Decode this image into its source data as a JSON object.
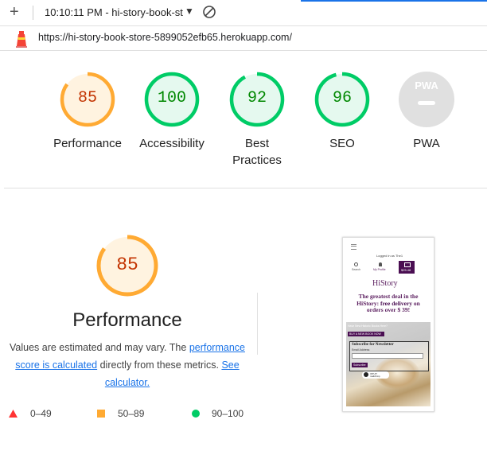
{
  "toolbar": {
    "time_title": "10:10:11 PM - hi-story-book-st"
  },
  "urlbar": {
    "url": "https://hi-story-book-store-5899052efb65.herokuapp.com/"
  },
  "colors": {
    "average": "#fa3",
    "average_text": "#c33300",
    "average_bg": "#fff3e0",
    "pass": "#0c6",
    "pass_text": "#008800",
    "pass_bg": "#e5f9ef",
    "fail": "#f33",
    "na": "#e0e0e0",
    "link": "#1a73e8"
  },
  "gauges": [
    {
      "score": "85",
      "label": "Performance",
      "rating": "average"
    },
    {
      "score": "100",
      "label": "Accessibility",
      "rating": "pass"
    },
    {
      "score": "92",
      "label": "Best Practices",
      "rating": "pass"
    },
    {
      "score": "96",
      "label": "SEO",
      "rating": "pass"
    },
    {
      "score": "PWA",
      "label": "PWA",
      "rating": "na"
    }
  ],
  "performance": {
    "score": "85",
    "title": "Performance",
    "note_prefix": "Values are estimated and may vary. The",
    "note_link": "performance score is calculated",
    "note_middle": "directly from these metrics.",
    "calculator_link": "See calculator."
  },
  "legend": [
    {
      "range": "0–49",
      "shape": "triangle"
    },
    {
      "range": "50–89",
      "shape": "square"
    },
    {
      "range": "90–100",
      "shape": "circle"
    }
  ],
  "screenshot": {
    "logged_in": "Logged in as The1",
    "search": "Search",
    "my_profile": "My Profile",
    "bag_total": "$25.48",
    "brand": "HiStory",
    "promo_pre": "The greatest deal in the HiStory:",
    "promo_bold": "free delivery",
    "promo_post": "on orders over $ 39!",
    "banner_text": "Have New Historic Books Here?",
    "buy_button": "BUY A NEW BOOK NOW",
    "newsletter": "Subscribe for Newsletter",
    "email_label": "Email Address",
    "subscribe": "Subscribe",
    "badge": "INTUIT mailchimp"
  }
}
